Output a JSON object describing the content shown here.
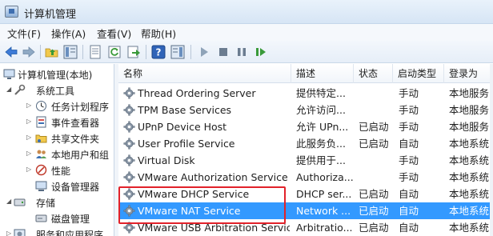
{
  "window": {
    "title": "计算机管理"
  },
  "menu": [
    "文件(F)",
    "操作(A)",
    "查看(V)",
    "帮助(H)"
  ],
  "toolbar": [
    "back-icon",
    "forward-icon",
    "up-folder-icon",
    "show-hide-tree-icon",
    "properties-icon",
    "refresh-icon",
    "export-list-icon",
    "help-icon",
    "show-hide-action-pane-icon",
    "start-service-icon",
    "stop-service-icon",
    "pause-service-icon",
    "resume-service-icon"
  ],
  "tree": [
    {
      "label": "计算机管理(本地)",
      "icon": "computer-icon",
      "expander": ""
    },
    {
      "label": "系统工具",
      "icon": "tools-icon",
      "expander": "◢"
    },
    {
      "label": "任务计划程序",
      "icon": "clock-icon",
      "expander": "▷"
    },
    {
      "label": "事件查看器",
      "icon": "event-viewer-icon",
      "expander": "▷"
    },
    {
      "label": "共享文件夹",
      "icon": "shared-folder-icon",
      "expander": "▷"
    },
    {
      "label": "本地用户和组",
      "icon": "users-icon",
      "expander": "▷"
    },
    {
      "label": "性能",
      "icon": "performance-icon",
      "expander": "▷"
    },
    {
      "label": "设备管理器",
      "icon": "device-manager-icon",
      "expander": ""
    },
    {
      "label": "存储",
      "icon": "storage-icon",
      "expander": "◢"
    },
    {
      "label": "磁盘管理",
      "icon": "disk-icon",
      "expander": ""
    },
    {
      "label": "服务和应用程序",
      "icon": "services-apps-icon",
      "expander": "▷"
    }
  ],
  "columns": [
    "名称",
    "描述",
    "状态",
    "启动类型",
    "登录为"
  ],
  "services": [
    {
      "name": "Thread Ordering Server",
      "desc": "提供特定...",
      "status": "",
      "startup": "手动",
      "logon": "本地服务"
    },
    {
      "name": "TPM Base Services",
      "desc": "允许访问...",
      "status": "",
      "startup": "手动",
      "logon": "本地服务"
    },
    {
      "name": "UPnP Device Host",
      "desc": "允许 UPn...",
      "status": "已启动",
      "startup": "手动",
      "logon": "本地服务"
    },
    {
      "name": "User Profile Service",
      "desc": "此服务负...",
      "status": "已启动",
      "startup": "自动",
      "logon": "本地系统"
    },
    {
      "name": "Virtual Disk",
      "desc": "提供用于...",
      "status": "",
      "startup": "手动",
      "logon": "本地系统"
    },
    {
      "name": "VMware Authorization Service",
      "desc": "Authoriza...",
      "status": "",
      "startup": "手动",
      "logon": "本地系统"
    },
    {
      "name": "VMware DHCP Service",
      "desc": "DHCP ser...",
      "status": "已启动",
      "startup": "自动",
      "logon": "本地系统"
    },
    {
      "name": "VMware NAT Service",
      "desc": "Network ...",
      "status": "已启动",
      "startup": "自动",
      "logon": "本地系统"
    },
    {
      "name": "VMware USB Arbitration Service",
      "desc": "Arbitratio...",
      "status": "已启动",
      "startup": "自动",
      "logon": "本地系统"
    }
  ],
  "selected_service": "VMware NAT Service",
  "colors": {
    "selection": "#3399ff",
    "highlight": "#e2222a"
  }
}
